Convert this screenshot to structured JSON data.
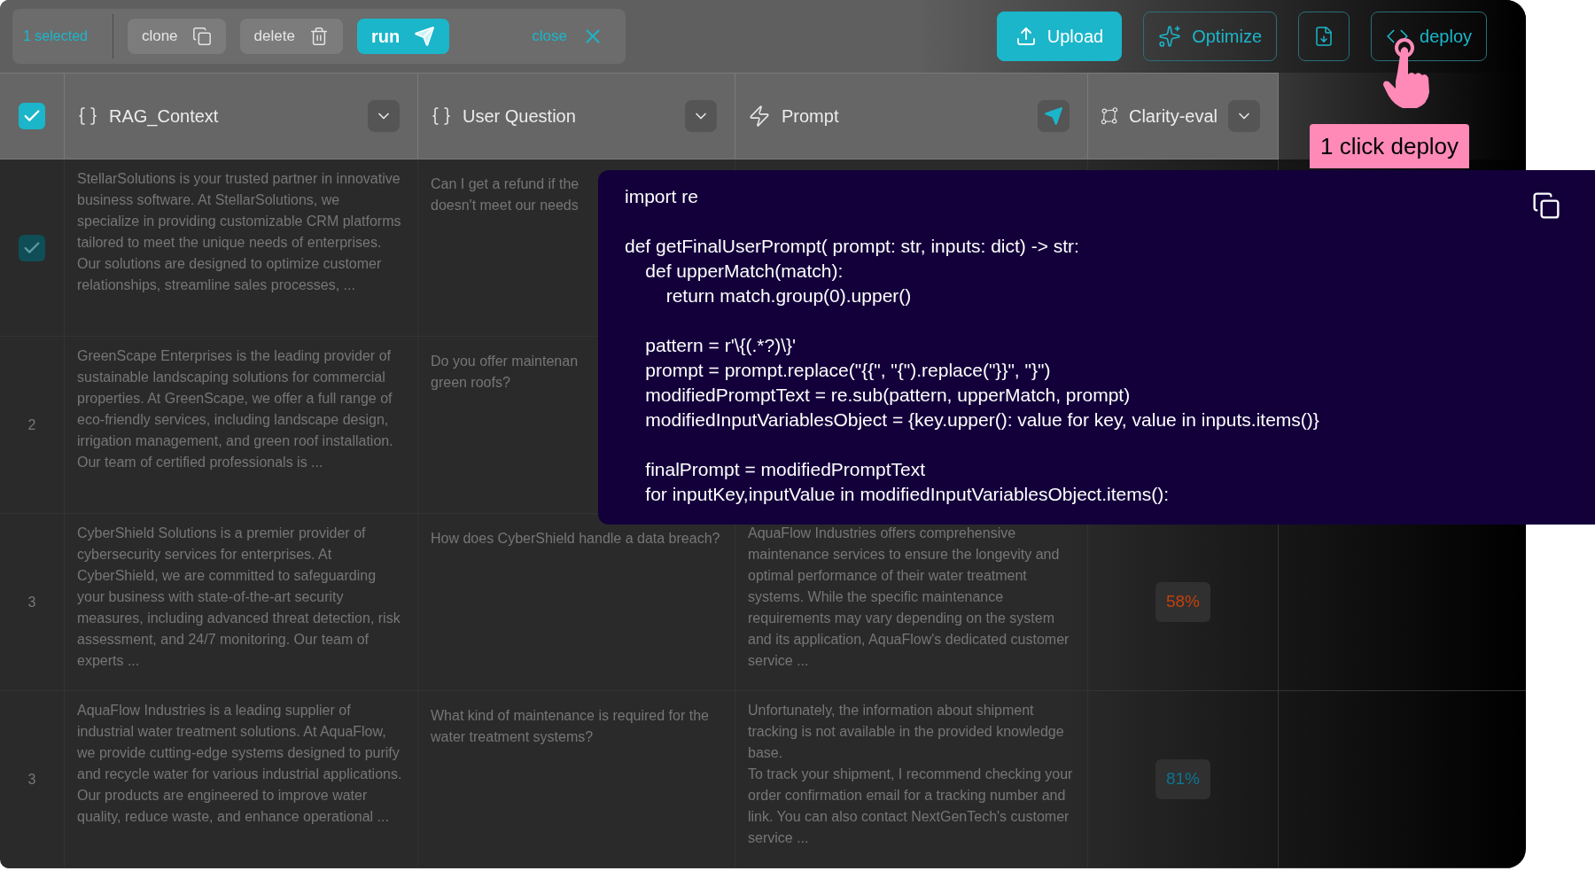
{
  "toolbar": {
    "selection_count": "1 selected",
    "actions": [
      {
        "kind": "clone",
        "label": "clone"
      },
      {
        "kind": "delete",
        "label": "delete"
      },
      {
        "kind": "run",
        "label": "run"
      }
    ],
    "close": "close"
  },
  "top_actions": [
    {
      "kind": "upload",
      "label": "Upload"
    },
    {
      "kind": "optimize",
      "label": "Optimize"
    },
    {
      "kind": "download"
    },
    {
      "kind": "deploy",
      "label": "deploy"
    }
  ],
  "tooltip": "1 click deploy",
  "table": {
    "select_all": {
      "checked": true
    },
    "columns": [
      {
        "kind": "variable",
        "label": "RAG_Context"
      },
      {
        "kind": "variable",
        "label": "User Question"
      },
      {
        "kind": "prompt",
        "label": "Prompt"
      },
      {
        "kind": "eval",
        "label": "Clarity-eval"
      }
    ],
    "rows": [
      {
        "selected": true,
        "context": "StellarSolutions is your trusted partner in innovative business software. At StellarSolutions, we specialize in providing customizable CRM platforms tailored to meet the unique needs of enterprises. Our solutions are designed to optimize customer relationships, streamline sales processes, ...",
        "question_lines": [
          "Can I get a refund if the",
          "doesn't meet our needs"
        ]
      },
      {
        "selected": false,
        "number": "2",
        "context": "GreenScape Enterprises is the leading provider of sustainable landscaping solutions for commercial properties. At GreenScape, we offer a full range of eco-friendly services, including landscape design, irrigation management, and green roof installation. Our team of certified professionals is ...",
        "question_lines": [
          "Do you offer maintenan",
          "green roofs?"
        ]
      },
      {
        "selected": false,
        "number": "3",
        "context": "CyberShield Solutions is a premier provider of cybersecurity services for enterprises. At CyberShield, we are committed to safeguarding your business with state-of-the-art security measures, including advanced threat detection, risk assessment, and 24/7 monitoring. Our team of experts ...",
        "question": "How does CyberShield handle a data breach?",
        "prompt": "AquaFlow Industries offers comprehensive maintenance services to ensure the longevity and optimal performance of their water treatment systems. While the specific maintenance requirements may vary depending on the system and its application, AquaFlow's dedicated customer service ...",
        "score": {
          "value": "58%",
          "color": "#c2410c"
        }
      },
      {
        "selected": false,
        "number": "3",
        "context": "AquaFlow Industries is a leading supplier of industrial water treatment solutions. At AquaFlow, we provide cutting-edge systems designed to purify and recycle water for various industrial applications. Our products are engineered to improve water quality, reduce waste, and enhance operational ...",
        "question": "What kind of maintenance is required for the water treatment systems?",
        "prompt": "Unfortunately, the information about shipment tracking is not available in the provided knowledge base.\nTo track your shipment, I recommend checking your order confirmation email for a tracking number and link. You can also contact NextGenTech's customer service ...",
        "score": {
          "value": "81%",
          "color": "#0e7490"
        }
      }
    ]
  },
  "code_popup": {
    "blocks": [
      [
        "import re"
      ],
      [
        "def getFinalUserPrompt( prompt: str, inputs: dict) -> str:",
        "    def upperMatch(match):",
        "        return match.group(0).upper()"
      ],
      [
        "    pattern = r'\\{(.*?)\\}'",
        "    prompt = prompt.replace(\"{{\", \"{\").replace(\"}}\", \"}\")",
        "    modifiedPromptText = re.sub(pattern, upperMatch, prompt)",
        "    modifiedInputVariablesObject = {key.upper(): value for key, value in inputs.items()}"
      ],
      [
        "    finalPrompt = modifiedPromptText",
        "    for inputKey,inputValue in modifiedInputVariablesObject.items():"
      ]
    ]
  }
}
